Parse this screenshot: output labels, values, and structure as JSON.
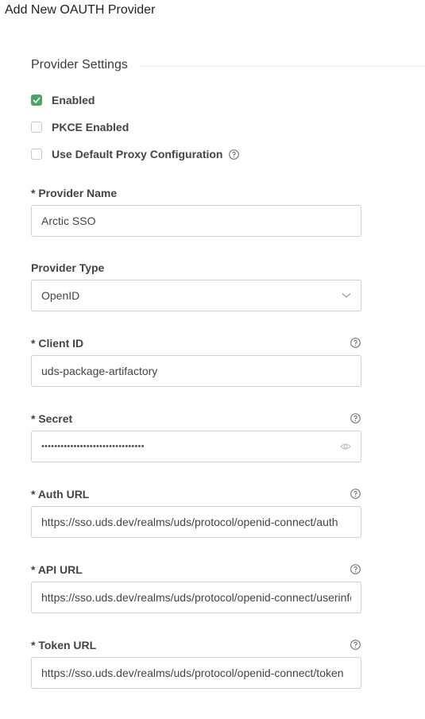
{
  "page": {
    "title": "Add New OAUTH Provider"
  },
  "section": {
    "title": "Provider Settings"
  },
  "checkboxes": {
    "enabled": {
      "label": "Enabled",
      "checked": true
    },
    "pkce": {
      "label": "PKCE Enabled",
      "checked": false
    },
    "proxy": {
      "label": "Use Default Proxy Configuration",
      "checked": false
    }
  },
  "fields": {
    "provider_name": {
      "label": "* Provider Name",
      "value": "Arctic SSO"
    },
    "provider_type": {
      "label": "Provider Type",
      "value": "OpenID"
    },
    "client_id": {
      "label": "* Client ID",
      "value": "uds-package-artifactory"
    },
    "secret": {
      "label": "* Secret",
      "masked": "••••••••••••••••••••••••••••••••"
    },
    "auth_url": {
      "label": "* Auth URL",
      "value": "https://sso.uds.dev/realms/uds/protocol/openid-connect/auth"
    },
    "api_url": {
      "label": "* API URL",
      "value": "https://sso.uds.dev/realms/uds/protocol/openid-connect/userinfo"
    },
    "token_url": {
      "label": "* Token URL",
      "value": "https://sso.uds.dev/realms/uds/protocol/openid-connect/token"
    }
  },
  "icons": {
    "check": "checkmark-icon",
    "help": "question-circle-icon",
    "chevron": "chevron-down-icon",
    "eye": "eye-icon"
  },
  "colors": {
    "accent": "#4aa564",
    "border": "#d0d0d0"
  }
}
